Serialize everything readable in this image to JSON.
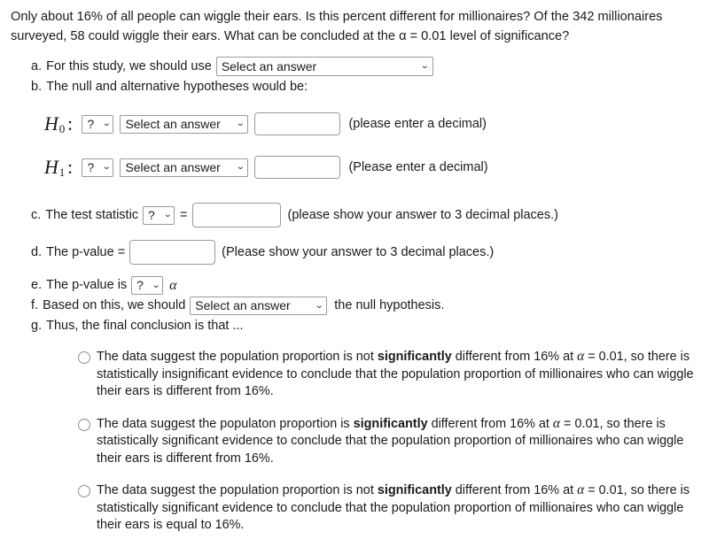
{
  "problem": {
    "intro": "Only about 16% of all people can wiggle their ears. Is this percent different for millionaires? Of the 342 millionaires surveyed, 58 could wiggle their ears. What can be concluded at the α = 0.01 level of significance?"
  },
  "part_a": {
    "letter": "a.",
    "text": "For this study, we should use",
    "select_value": "Select an answer",
    "chevron": "⌄"
  },
  "part_b": {
    "letter": "b.",
    "text": "The null and alternative hypotheses would be:",
    "null_hypothesis": {
      "symbol": "H",
      "subscript": "0",
      "colon": ":",
      "operator_value": "?",
      "answer_value": "Select an answer",
      "input_value": "",
      "note": "(please enter a decimal)"
    },
    "alt_hypothesis": {
      "symbol": "H",
      "subscript": "1",
      "colon": ":",
      "operator_value": "?",
      "answer_value": "Select an answer",
      "input_value": "",
      "note": "(Please enter a decimal)"
    }
  },
  "part_c": {
    "letter": "c.",
    "text": "The test statistic",
    "statistic_value": "?",
    "equals": "=",
    "input_value": "",
    "note": "(please show your answer to 3 decimal places.)"
  },
  "part_d": {
    "letter": "d.",
    "text": "The p-value =",
    "input_value": "",
    "note": "(Please show your answer to 3 decimal places.)"
  },
  "part_e": {
    "letter": "e.",
    "text": "The p-value is",
    "comparison_value": "?",
    "alpha": "α"
  },
  "part_f": {
    "letter": "f.",
    "text_before": "Based on this, we should",
    "select_value": "Select an answer",
    "text_after": "the null hypothesis."
  },
  "part_g": {
    "letter": "g.",
    "text": "Thus, the final conclusion is that ...",
    "options": [
      {
        "seg1": "The data suggest the population proportion is not ",
        "bold": "significantly",
        "seg2": " different from 16% at ",
        "alpha": "α",
        "seg3": " = 0.01, so there is statistically insignificant evidence to conclude that the population proportion of millionaires who can wiggle their ears is different from 16%."
      },
      {
        "seg1": "The data suggest the populaton proportion is ",
        "bold": "significantly",
        "seg2": " different from 16% at ",
        "alpha": "α",
        "seg3": " = 0.01, so there is statistically significant evidence to conclude that the population proportion of millionaires who can wiggle their ears is different from 16%."
      },
      {
        "seg1": "The data suggest the population proportion is not ",
        "bold": "significantly",
        "seg2": " different from 16% at ",
        "alpha": "α",
        "seg3": " = 0.01, so there is statistically significant evidence to conclude that the population proportion of millionaires who can wiggle their ears is equal to 16%."
      }
    ]
  }
}
